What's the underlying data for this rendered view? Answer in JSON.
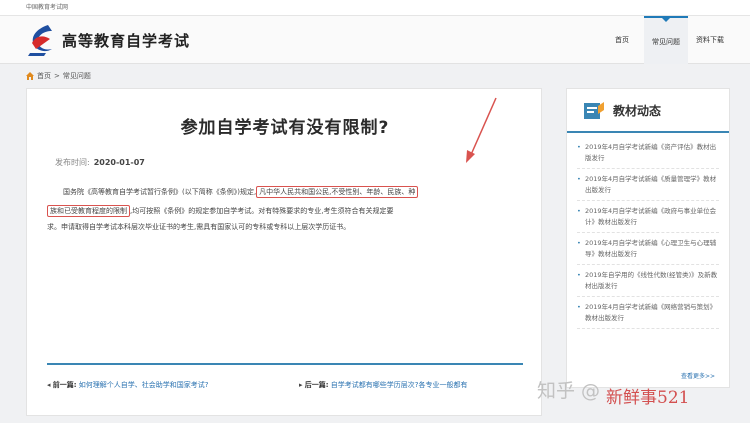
{
  "topbar": {
    "text": "中国教育考试网"
  },
  "header": {
    "site_title": "高等教育自学考试",
    "nav": [
      {
        "label": "首页",
        "active": false
      },
      {
        "label": "常见问题",
        "active": true
      },
      {
        "label": "资料下载",
        "active": false
      }
    ]
  },
  "breadcrumb": {
    "home": "首页",
    "sep": ">",
    "current": "常见问题"
  },
  "article": {
    "title": "参加自学考试有没有限制?",
    "pubdate_label": "发布时间:",
    "pubdate": "2020-01-07",
    "para1_pre": "国务院《高等教育自学考试暂行条例》(以下简称《条例》)规定,",
    "para1_hl1": "凡中华人民共和国公民,不受性别、年龄、民族、种",
    "para2_hl2": "族和已受教育程度的限制",
    "para2_post": ",均可按照《条例》的规定参加自学考试。对有特殊要求的专业,考生须符合有关规定要",
    "para3": "求。申请取得自学考试本科层次毕业证书的考生,需具有国家认可的专科或专科以上层次学历证书。",
    "prev_label": "前一篇:",
    "prev_link": "如何理解个人自学、社会助学和国家考试?",
    "next_label": "后一篇:",
    "next_link": "自学考试都有哪些学历层次?各专业一般都有"
  },
  "sidebar": {
    "title": "教材动态",
    "items": [
      "2019年4月自学考试新编《资产评估》教材出版发行",
      "2019年4月自学考试新编《质量管理学》教材出版发行",
      "2019年4月自学考试新编《政府与事业单位会计》教材出版发行",
      "2019年4月自学考试新编《心理卫生与心理辅导》教材出版发行",
      "2019年自学用的《线性代数(经管类)》及新教材出版发行",
      "2019年4月自学考试新编《网络营销与策划》教材出版发行"
    ],
    "more": "查看更多>>"
  },
  "watermark": {
    "zhihu": "知乎 @",
    "brand": "新鲜事521"
  },
  "colors": {
    "accent": "#3a86b4",
    "highlight": "#d9534f",
    "link": "#2a72b0"
  }
}
